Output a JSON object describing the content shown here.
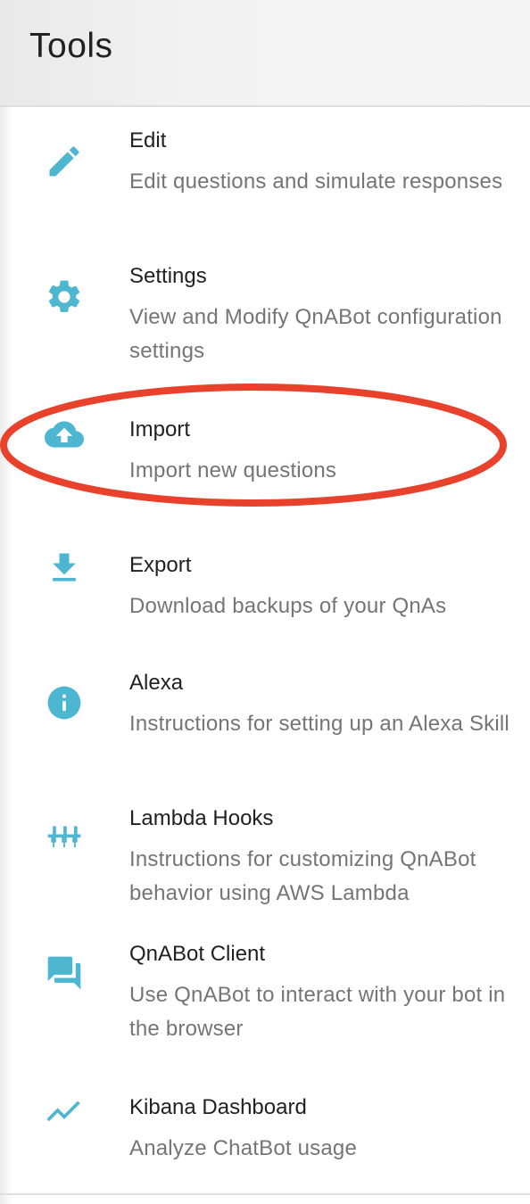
{
  "header": {
    "title": "Tools"
  },
  "accent_color": "#4db6d0",
  "highlight_color": "#e8412c",
  "items": [
    {
      "title": "Edit",
      "subtitle": "Edit questions and simulate responses",
      "icon": "pencil-icon"
    },
    {
      "title": "Settings",
      "subtitle": "View and Modify QnABot configuration settings",
      "icon": "gear-icon"
    },
    {
      "title": "Import",
      "subtitle": "Import new questions",
      "icon": "cloud-upload-icon"
    },
    {
      "title": "Export",
      "subtitle": "Download backups of your QnAs",
      "icon": "download-icon"
    },
    {
      "title": "Alexa",
      "subtitle": "Instructions for setting up an Alexa Skill",
      "icon": "info-icon"
    },
    {
      "title": "Lambda Hooks",
      "subtitle": "Instructions for customizing QnABot behavior using AWS Lambda",
      "icon": "input-hooks-icon"
    },
    {
      "title": "QnABot Client",
      "subtitle": "Use QnABot to interact with your bot in the browser",
      "icon": "chat-icon"
    },
    {
      "title": "Kibana Dashboard",
      "subtitle": "Analyze ChatBot usage",
      "icon": "trending-line-icon"
    }
  ]
}
